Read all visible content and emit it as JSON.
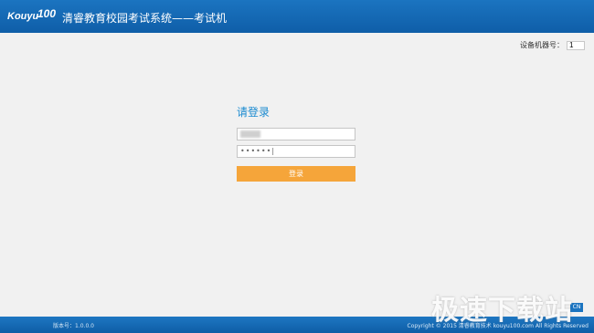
{
  "header": {
    "logo_text": "Kouyu100",
    "app_title": "清睿教育校园考试系统——考试机"
  },
  "device": {
    "label": "设备机器号：",
    "value": "1"
  },
  "login": {
    "title": "请登录",
    "username_value": "",
    "password_value": "••••••|",
    "button_label": "登录"
  },
  "footer": {
    "version": "版本号：1.0.0.0",
    "copyright": "Copyright © 2015 清睿教育技术 kouyu100.com All Rights Reserved"
  },
  "watermark": {
    "text": "极速下载站"
  },
  "corner_badge": "CN",
  "colors": {
    "header_blue": "#1b74c0",
    "accent_orange": "#f5a53a",
    "title_blue": "#1a8ad0",
    "background": "#f1f1f1"
  }
}
